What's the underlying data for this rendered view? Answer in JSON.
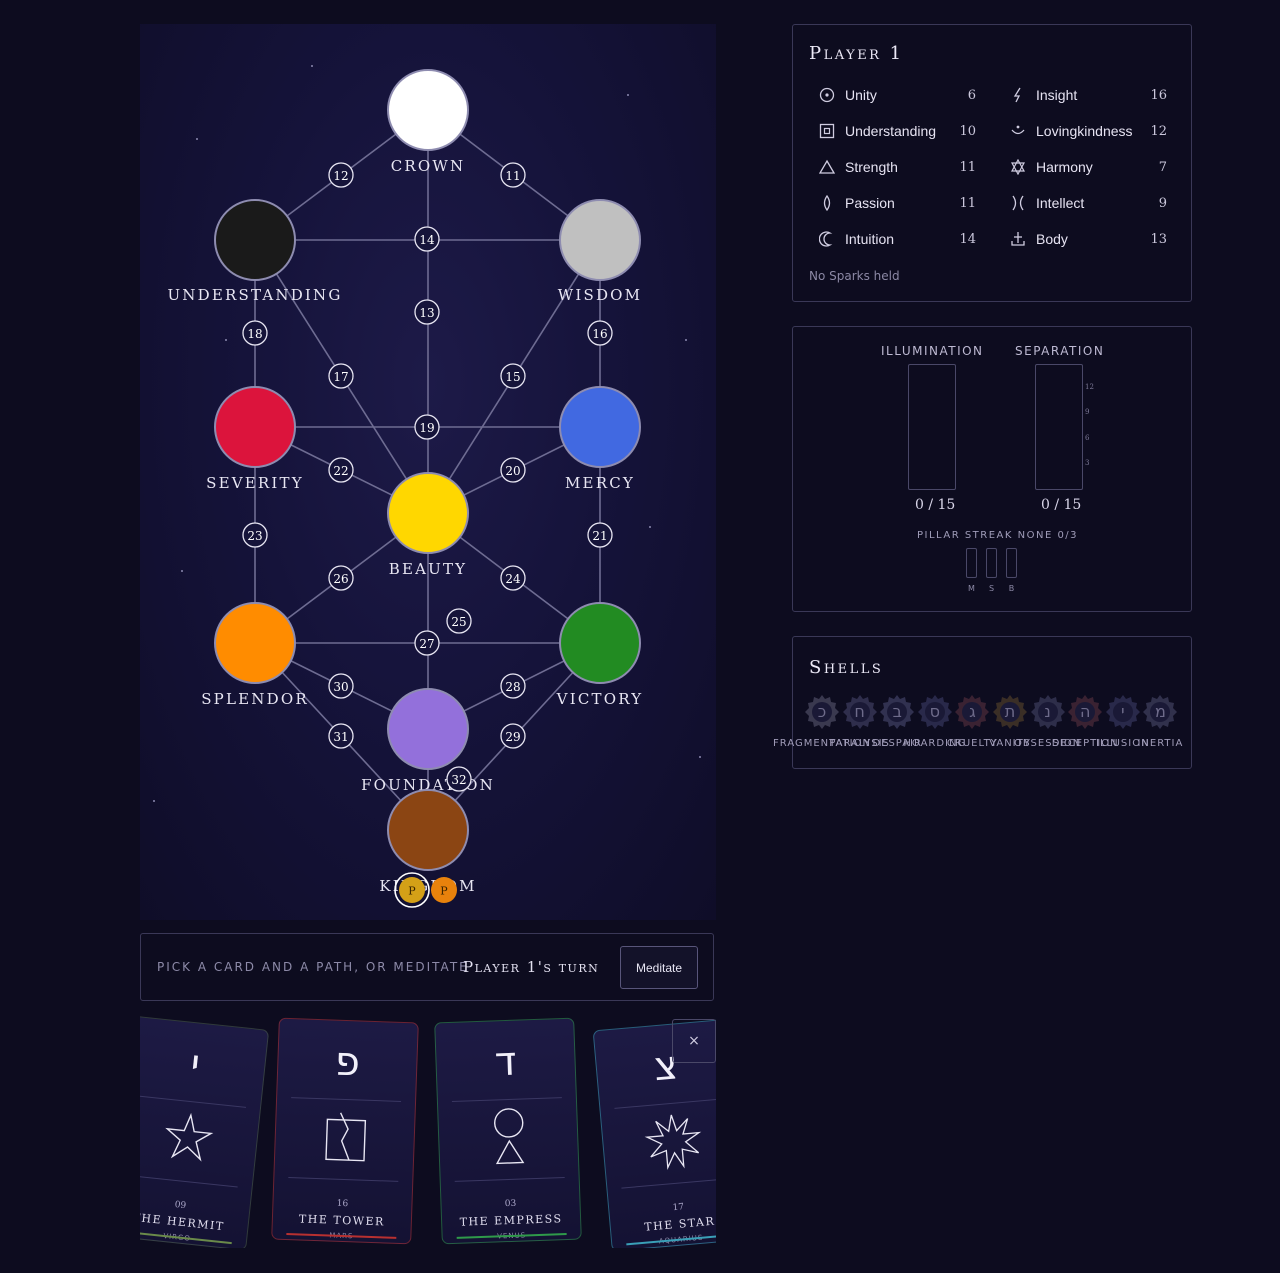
{
  "board": {
    "sephirot": [
      {
        "id": "crown",
        "label": "CROWN",
        "color": "#ffffff"
      },
      {
        "id": "understanding",
        "label": "UNDERSTANDING",
        "color": "#1a1a1a"
      },
      {
        "id": "wisdom",
        "label": "WISDOM",
        "color": "#c0c0c0"
      },
      {
        "id": "severity",
        "label": "SEVERITY",
        "color": "#dc143c"
      },
      {
        "id": "mercy",
        "label": "MERCY",
        "color": "#4169e1"
      },
      {
        "id": "beauty",
        "label": "BEAUTY",
        "color": "#ffd700"
      },
      {
        "id": "splendor",
        "label": "SPLENDOR",
        "color": "#ff8c00"
      },
      {
        "id": "victory",
        "label": "VICTORY",
        "color": "#228b22"
      },
      {
        "id": "foundation",
        "label": "FOUNDATION",
        "color": "#9370db"
      },
      {
        "id": "kingdom",
        "label": "KINGDOM",
        "color": "#8b4513"
      }
    ],
    "paths": [
      {
        "num": "11",
        "from": "crown",
        "to": "wisdom"
      },
      {
        "num": "12",
        "from": "crown",
        "to": "understanding"
      },
      {
        "num": "13",
        "from": "crown",
        "to": "beauty"
      },
      {
        "num": "14",
        "from": "understanding",
        "to": "wisdom"
      },
      {
        "num": "15",
        "from": "wisdom",
        "to": "beauty"
      },
      {
        "num": "16",
        "from": "wisdom",
        "to": "mercy"
      },
      {
        "num": "17",
        "from": "understanding",
        "to": "beauty"
      },
      {
        "num": "18",
        "from": "understanding",
        "to": "severity"
      },
      {
        "num": "19",
        "from": "severity",
        "to": "mercy"
      },
      {
        "num": "20",
        "from": "mercy",
        "to": "beauty"
      },
      {
        "num": "21",
        "from": "mercy",
        "to": "victory"
      },
      {
        "num": "22",
        "from": "severity",
        "to": "beauty"
      },
      {
        "num": "23",
        "from": "severity",
        "to": "splendor"
      },
      {
        "num": "24",
        "from": "beauty",
        "to": "victory"
      },
      {
        "num": "25",
        "from": "beauty",
        "to": "foundation"
      },
      {
        "num": "26",
        "from": "beauty",
        "to": "splendor"
      },
      {
        "num": "27",
        "from": "splendor",
        "to": "victory"
      },
      {
        "num": "28",
        "from": "victory",
        "to": "foundation"
      },
      {
        "num": "29",
        "from": "victory",
        "to": "kingdom"
      },
      {
        "num": "30",
        "from": "splendor",
        "to": "foundation"
      },
      {
        "num": "31",
        "from": "splendor",
        "to": "kingdom"
      },
      {
        "num": "32",
        "from": "foundation",
        "to": "kingdom"
      }
    ],
    "tokens": [
      {
        "label": "P",
        "color": "#d4a017",
        "active": true
      },
      {
        "label": "P",
        "color": "#e8820c",
        "active": false
      }
    ]
  },
  "action_bar": {
    "prompt": "PICK A CARD AND A PATH, OR MEDITATE",
    "turn": "Player 1's turn",
    "meditate_label": "Meditate"
  },
  "hand": {
    "close_label": "×",
    "cards": [
      {
        "letter": "י",
        "number": "09",
        "name": "THE HERMIT",
        "sub": "VIRGO",
        "symbol": "star-icon",
        "accent": "#6a8a4a"
      },
      {
        "letter": "פ",
        "number": "16",
        "name": "THE TOWER",
        "sub": "MARS",
        "symbol": "tower-icon",
        "accent": "#b83030"
      },
      {
        "letter": "ד",
        "number": "03",
        "name": "THE EMPRESS",
        "sub": "VENUS",
        "symbol": "venus-icon",
        "accent": "#2f9a4a"
      },
      {
        "letter": "צ",
        "number": "17",
        "name": "THE STAR",
        "sub": "AQUARIUS",
        "symbol": "starburst-icon",
        "accent": "#3aa0b8"
      }
    ]
  },
  "player": {
    "title": "Player 1",
    "attributes": [
      {
        "name": "Unity",
        "value": "6",
        "icon": "circle-dot-icon"
      },
      {
        "name": "Insight",
        "value": "16",
        "icon": "lightning-icon"
      },
      {
        "name": "Understanding",
        "value": "10",
        "icon": "square-dot-icon"
      },
      {
        "name": "Lovingkindness",
        "value": "12",
        "icon": "bowl-icon"
      },
      {
        "name": "Strength",
        "value": "11",
        "icon": "triangle-icon"
      },
      {
        "name": "Harmony",
        "value": "7",
        "icon": "hexagram-icon"
      },
      {
        "name": "Passion",
        "value": "11",
        "icon": "flame-icon"
      },
      {
        "name": "Intellect",
        "value": "9",
        "icon": "hourglass-icon"
      },
      {
        "name": "Intuition",
        "value": "14",
        "icon": "moon-icon"
      },
      {
        "name": "Body",
        "value": "13",
        "icon": "anchor-icon"
      }
    ],
    "sparks": "No Sparks held"
  },
  "meters": {
    "illumination": {
      "label": "ILLUMINATION",
      "value": "0 / 15",
      "fraction": 0
    },
    "separation": {
      "label": "SEPARATION",
      "value": "0 / 15",
      "fraction": 0
    },
    "ticks": [
      "12",
      "9",
      "6",
      "3"
    ],
    "streak": "PILLAR STREAK NONE 0/3",
    "pillars": [
      "M",
      "S",
      "B"
    ]
  },
  "shells": {
    "title": "Shells",
    "items": [
      {
        "letter": "כ",
        "name": "FRAGMENTATION"
      },
      {
        "letter": "ח",
        "name": "PARALYSIS"
      },
      {
        "letter": "ב",
        "name": "DESPAIR"
      },
      {
        "letter": "ס",
        "name": "HOARDING"
      },
      {
        "letter": "ג",
        "name": "CRUELTY"
      },
      {
        "letter": "ת",
        "name": "VANITY"
      },
      {
        "letter": "נ",
        "name": "OBSESSION"
      },
      {
        "letter": "ה",
        "name": "DECEPTION"
      },
      {
        "letter": "י",
        "name": "ILLUSION"
      },
      {
        "letter": "מ",
        "name": "INERTIA"
      }
    ],
    "colors": [
      "#4a4860",
      "#3b3a5c",
      "#3e3d62",
      "#33335a",
      "#4a2a3a",
      "#4a3a2a",
      "#3a3a5a",
      "#4a2a3a",
      "#33335a",
      "#3e3d5c"
    ]
  }
}
